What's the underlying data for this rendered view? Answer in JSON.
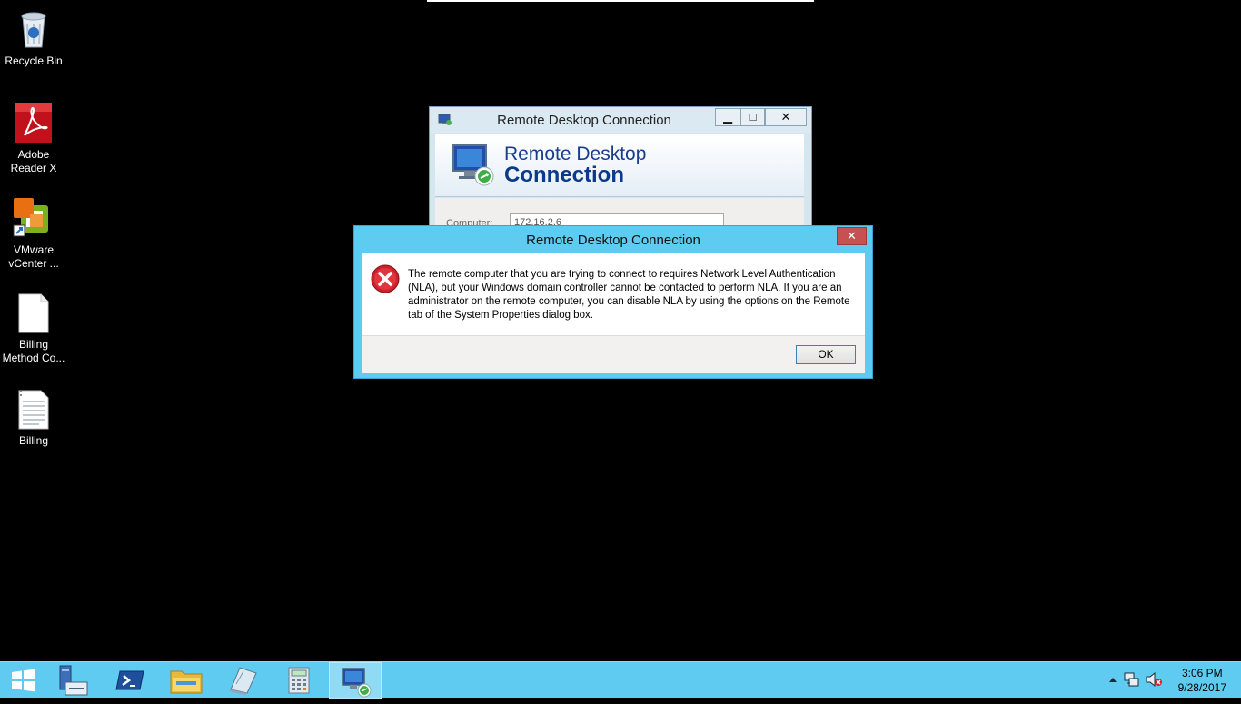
{
  "desktop": {
    "icons": [
      {
        "label": "Recycle Bin"
      },
      {
        "label": "Adobe\nReader X"
      },
      {
        "label": "VMware\nvCenter ..."
      },
      {
        "label": "Billing\nMethod Co..."
      },
      {
        "label": "Billing"
      }
    ]
  },
  "rdc_window": {
    "title": "Remote Desktop Connection",
    "banner_line1": "Remote Desktop",
    "banner_line2": "Connection",
    "computer_label": "Computer:",
    "computer_value": "172.16.2.6",
    "minimize": "▁",
    "maximize": "□",
    "close": "✕"
  },
  "error_dialog": {
    "title": "Remote Desktop Connection",
    "close": "✕",
    "message": "The remote computer that you are trying to connect to requires Network Level Authentication (NLA), but your Windows domain controller cannot be contacted to perform NLA. If you are an administrator on the remote computer, you can disable NLA by using the options on the Remote tab of the System Properties dialog box.",
    "ok_label": "OK"
  },
  "taskbar": {
    "items": [
      "start-icon",
      "server-manager-icon",
      "powershell-icon",
      "file-explorer-icon",
      "notepad-icon",
      "calculator-icon",
      "remote-desktop-icon"
    ],
    "clock_time": "3:06 PM",
    "clock_date": "9/28/2017"
  },
  "colors": {
    "taskbar": "#5fcbf0",
    "dialog_frame": "#5ecbf1",
    "close_red": "#c75050",
    "banner_blue": "#1a3e8c"
  }
}
